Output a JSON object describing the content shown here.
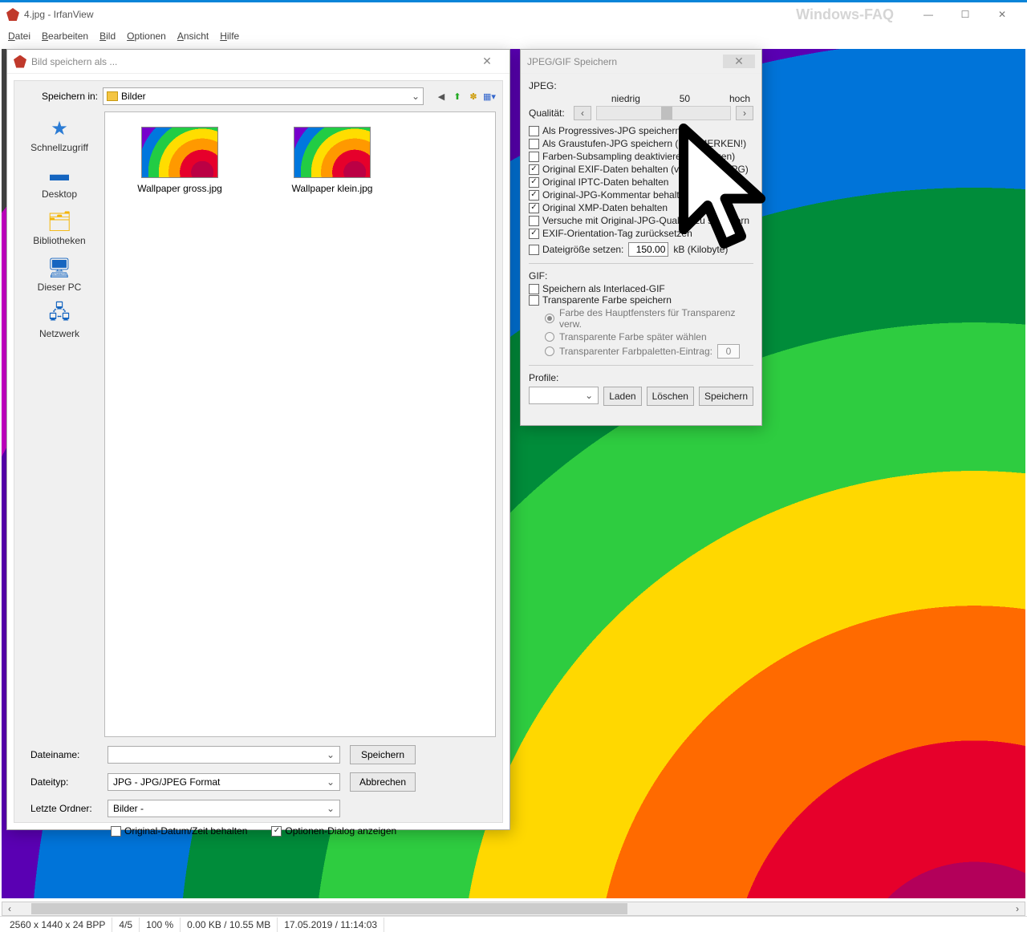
{
  "window": {
    "title": "4.jpg - IrfanView",
    "watermark": "Windows-FAQ"
  },
  "menu": {
    "file": "Datei",
    "edit": "Bearbeiten",
    "image": "Bild",
    "options": "Optionen",
    "view": "Ansicht",
    "help": "Hilfe"
  },
  "status": {
    "dim": "2560 x 1440 x 24 BPP",
    "idx": "4/5",
    "zoom": "100 %",
    "size": "0.00 KB / 10.55 MB",
    "date": "17.05.2019 / 11:14:03"
  },
  "saveDialog": {
    "title": "Bild speichern als ...",
    "saveInLabel": "Speichern in:",
    "folder": "Bilder",
    "places": {
      "quick": "Schnellzugriff",
      "desktop": "Desktop",
      "libs": "Bibliotheken",
      "pc": "Dieser PC",
      "net": "Netzwerk"
    },
    "files": [
      {
        "name": "Wallpaper gross.jpg"
      },
      {
        "name": "Wallpaper klein.jpg"
      }
    ],
    "filenameLabel": "Dateiname:",
    "filenameValue": "",
    "filetypeLabel": "Dateityp:",
    "filetypeValue": "JPG - JPG/JPEG Format",
    "recentLabel": "Letzte Ordner:",
    "recentValue": "Bilder  -",
    "saveBtn": "Speichern",
    "cancelBtn": "Abbrechen",
    "keepDate": "Original-Datum/Zeit behalten",
    "showOpts": "Optionen-Dialog anzeigen"
  },
  "optDialog": {
    "title": "JPEG/GIF Speichern",
    "jpegHeader": "JPEG:",
    "low": "niedrig",
    "value": "50",
    "high": "hoch",
    "qualityLabel": "Qualität:",
    "checks": [
      {
        "label": "Als Progressives-JPG speichern",
        "on": false
      },
      {
        "label": "Als Graustufen-JPG speichern (bitte MERKEN!)",
        "on": false
      },
      {
        "label": "Farben-Subsampling deaktivieren (benutzen)",
        "on": false
      },
      {
        "label": "Original EXIF-Daten behalten (von JPG zu JPG)",
        "on": true
      },
      {
        "label": "Original IPTC-Daten behalten",
        "on": true
      },
      {
        "label": "Original-JPG-Kommentar behalten",
        "on": true
      },
      {
        "label": "Original XMP-Daten behalten",
        "on": true
      },
      {
        "label": "Versuche mit Original-JPG-Qualität zu speichern",
        "on": false
      },
      {
        "label": "EXIF-Orientation-Tag zurücksetzen",
        "on": true
      }
    ],
    "setSize": "Dateigröße setzen:",
    "sizeVal": "150.00",
    "sizeUnit": "kB (Kilobyte)",
    "gifHeader": "GIF:",
    "gifInterlace": "Speichern als Interlaced-GIF",
    "gifTransparent": "Transparente Farbe speichern",
    "gifR1": "Farbe des Hauptfensters für Transparenz verw.",
    "gifR2": "Transparente Farbe später wählen",
    "gifR3": "Transparenter Farbpaletten-Eintrag:",
    "gifR3val": "0",
    "profileLabel": "Profile:",
    "loadBtn": "Laden",
    "delBtn": "Löschen",
    "saveBtn": "Speichern"
  }
}
